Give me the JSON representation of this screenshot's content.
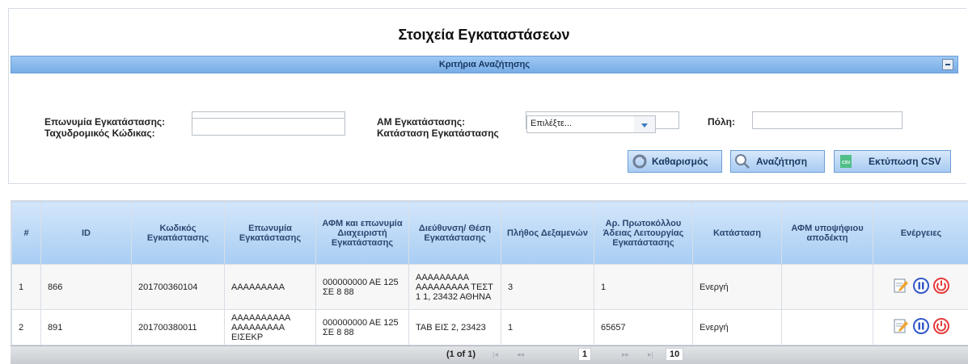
{
  "page": {
    "title": "Στοιχεία Εγκαταστάσεων"
  },
  "criteria": {
    "title": "Κριτήρια Αναζήτησης",
    "fields": {
      "name_label": "Επωνυμία Εγκατάστασης:",
      "am_label": "ΑΜ Εγκατάστασης:",
      "city_label": "Πόλη:",
      "zip_label": "Ταχυδρομικός Κώδικας:",
      "status_label": "Κατάσταση Εγκατάστασης",
      "status_value": "Επιλέξτε..."
    },
    "buttons": {
      "clear": "Καθαρισμός",
      "search": "Αναζήτηση",
      "export": "Εκτύπωση CSV"
    }
  },
  "table": {
    "headers": [
      "#",
      "ID",
      "Κωδικός Εγκατάστασης",
      "Επωνυμία Εγκατάστασης",
      "ΑΦΜ και επωνυμία Διαχειριστή Εγκατάστασης",
      "Διεύθυνση/ Θέση Εγκατάστασης",
      "Πλήθος Δεξαμενών",
      "Αρ. Πρωτοκόλλου Άδειας Λειτουργίας Εγκατάστασης",
      "Κατάσταση",
      "ΑΦΜ υποψήφιου αποδέκτη",
      "Ενέργειες"
    ],
    "rows": [
      [
        "1",
        "866",
        "201700360104",
        "ΑΑΑΑΑΑΑΑΑ",
        "000000000 ΑΕ 125 ΣΕ 8 88",
        "ΑΑΑΑΑΑΑΑΑ ΑΑΑΑΑΑΑΑΑ ΤΕΣΤ 1 1, 23432 ΑΘΗΝΑ",
        "3",
        "1",
        "Ενεργή",
        ""
      ],
      [
        "2",
        "891",
        "201700380011",
        "ΑΑΑΑΑΑΑΑΑΑ ΑΑΑΑΑΑΑΑΑ ΕΙΣΕΚΡ",
        "000000000 ΑΕ 125 ΣΕ 8 88",
        "ΤΑΒ ΕΙΣ 2, 23423",
        "1",
        "65657",
        "Ενεργή",
        ""
      ]
    ],
    "icons": {
      "edit": "edit-icon",
      "pause": "pause-icon",
      "power": "power-icon"
    }
  },
  "pager": {
    "summary": "(1 of 1)",
    "first": "|◂",
    "prev": "◂◂",
    "current": "1",
    "next": "▸▸",
    "last": "▸|",
    "page_size": "10"
  },
  "colors": {
    "accent": "#78ade6",
    "status_header": "#2b4770",
    "power_red": "#e53b3b",
    "pause_blue": "#3257c8"
  }
}
